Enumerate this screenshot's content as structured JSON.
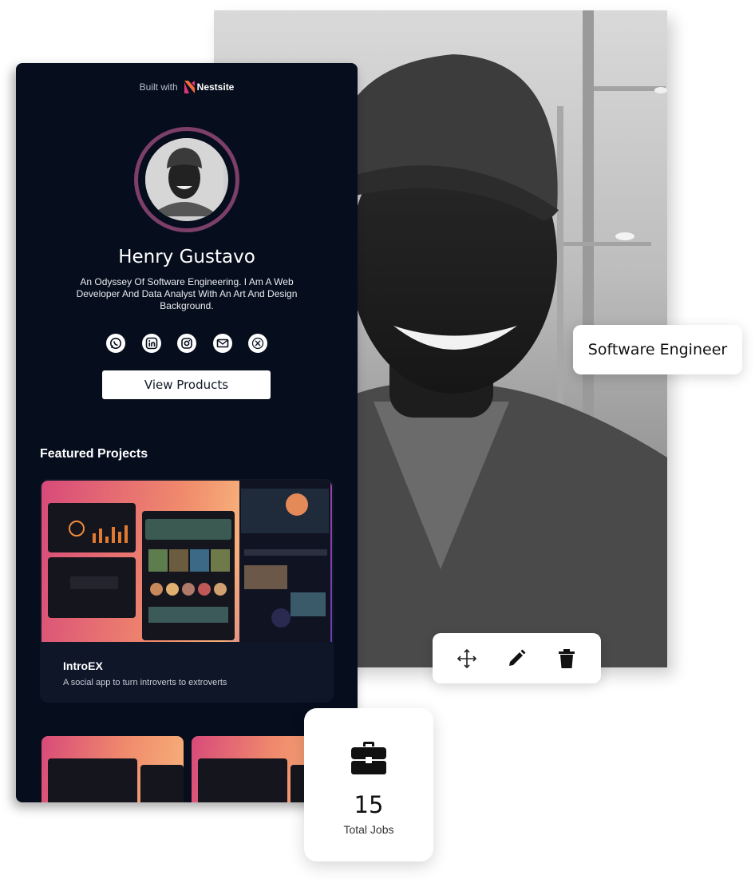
{
  "branding": {
    "built_with": "Built with",
    "brand_name": "Nestsite"
  },
  "profile": {
    "name": "Henry Gustavo",
    "bio": "An Odyssey Of Software Engineering. I Am A Web Developer And Data Analyst With An Art And Design Background.",
    "role": "Software Engineer",
    "socials": [
      "whatsapp-icon",
      "linkedin-icon",
      "instagram-icon",
      "mail-icon",
      "x-icon"
    ],
    "cta_label": "View Products"
  },
  "projects": {
    "section_title": "Featured Projects",
    "items": [
      {
        "title": "IntroEX",
        "description": "A social app to turn introverts to extroverts"
      }
    ]
  },
  "toolbar": {
    "tools": [
      "move-icon",
      "edit-pencil-icon",
      "delete-trash-icon"
    ]
  },
  "stats": {
    "total_jobs_value": "15",
    "total_jobs_label": "Total Jobs"
  },
  "colors": {
    "card_bg": "#060d1c",
    "avatar_ring": "#7c3f68",
    "brand_orange": "#f26b3a",
    "brand_pink": "#e0357a"
  }
}
